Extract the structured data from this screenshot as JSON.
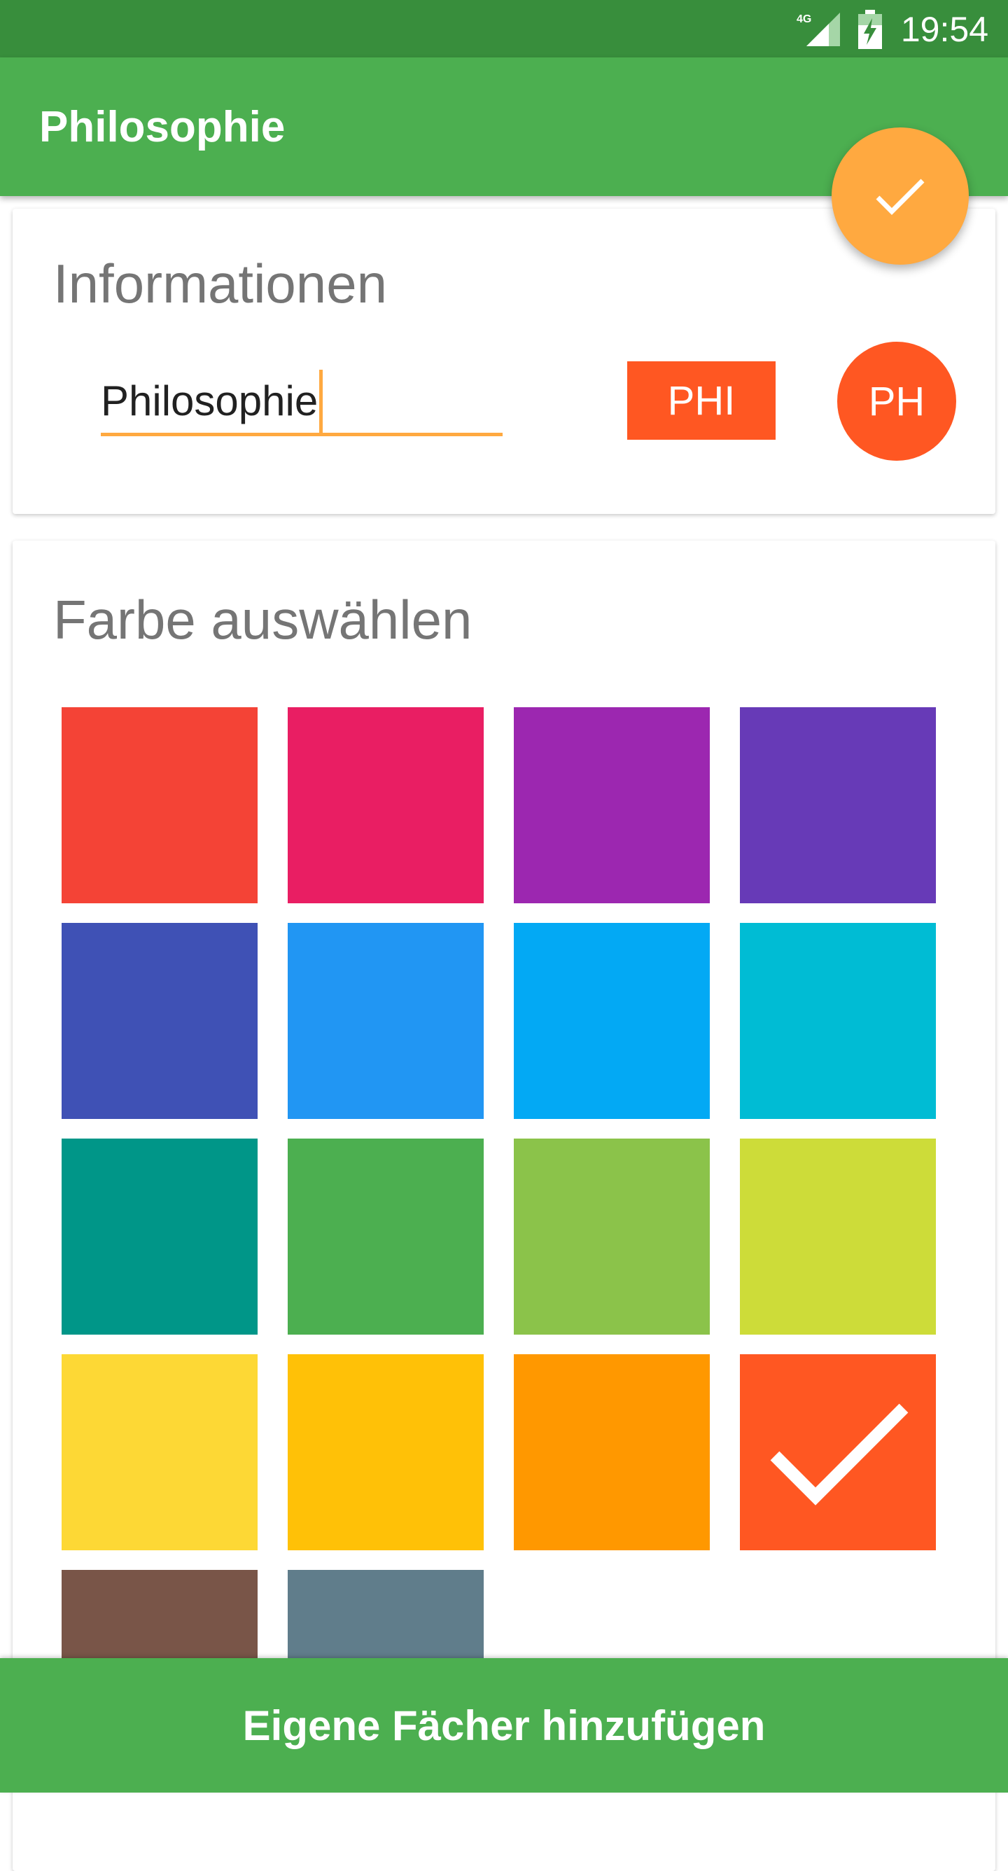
{
  "status_bar": {
    "time": "19:54",
    "network": "4G"
  },
  "app_bar": {
    "title": "Philosophie"
  },
  "fab": {
    "icon": "check-icon",
    "color": "#FFA940"
  },
  "info_card": {
    "title": "Informationen",
    "name_value": "Philosophie",
    "abbreviation": "PHI",
    "initials": "PH",
    "accent_color": "#FF5722"
  },
  "color_card": {
    "title": "Farbe auswählen",
    "selected_index": 15,
    "swatches": [
      "#F44336",
      "#E91E63",
      "#9C27B0",
      "#673AB7",
      "#3F51B5",
      "#2196F3",
      "#03A9F4",
      "#00BCD4",
      "#009688",
      "#4CAF50",
      "#8BC34A",
      "#CDDC39",
      "#FDD835",
      "#FFC107",
      "#FF9800",
      "#FF5722",
      "#795548",
      "#607D8B"
    ]
  },
  "bottom_bar": {
    "label": "Eigene Fächer hinzufügen"
  }
}
